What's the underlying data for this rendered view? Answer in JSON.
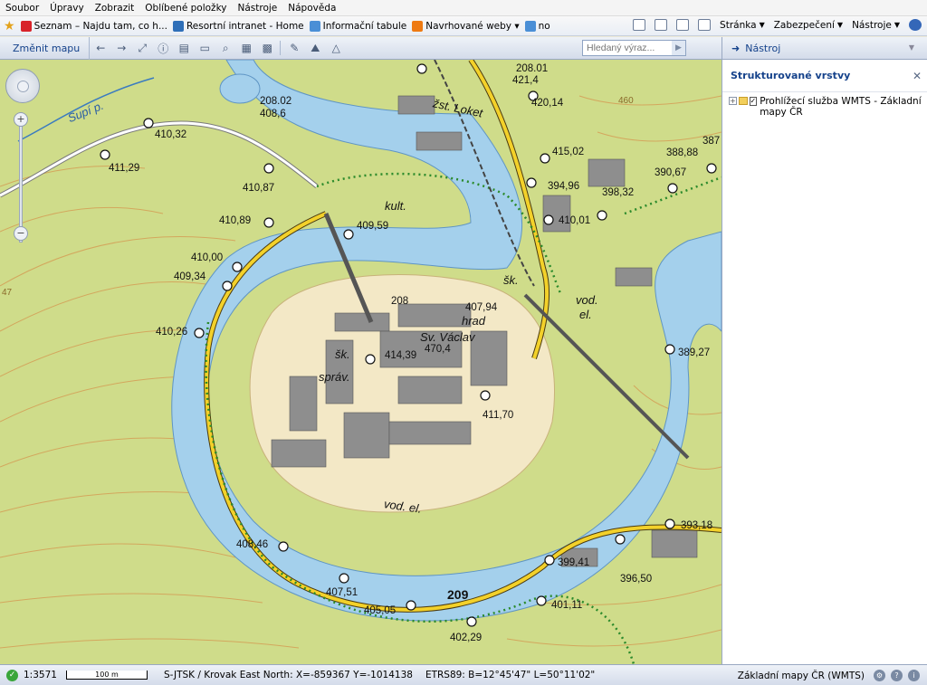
{
  "menu": [
    "Soubor",
    "Úpravy",
    "Zobrazit",
    "Oblíbené položky",
    "Nástroje",
    "Nápověda"
  ],
  "favorites": [
    {
      "label": "Seznam – Najdu tam, co h...",
      "color": "#d8232a"
    },
    {
      "label": "Resortní intranet - Home",
      "color": "#2f6fb8"
    },
    {
      "label": "Informační tabule",
      "color": "#4a8fd6"
    },
    {
      "label": "Navrhované weby ▾",
      "color": "#ee7a12"
    },
    {
      "label": "no",
      "color": "#4a8fd6"
    }
  ],
  "ie_toolbar": {
    "page": "Stránka",
    "security": "Zabezpečení",
    "tools": "Nástroje"
  },
  "app_toolbar": {
    "change_map": "Změnit mapu",
    "search_placeholder": "Hledaný výraz..."
  },
  "tool_panel": {
    "header": "Nástroj",
    "title": "Strukturované vrstvy",
    "layer_label": "Prohlížecí služba WMTS - Základní mapy ČR"
  },
  "map_labels": [
    {
      "text": "Supí p.",
      "cls": "it"
    },
    {
      "text": "208.02"
    },
    {
      "text": "408,6"
    },
    {
      "text": "410,32"
    },
    {
      "text": "411,29"
    },
    {
      "text": "410,87"
    },
    {
      "text": "410,89"
    },
    {
      "text": "409,59"
    },
    {
      "text": "kult.",
      "cls": "it"
    },
    {
      "text": "410,00"
    },
    {
      "text": "409,34"
    },
    {
      "text": "410,26"
    },
    {
      "text": "208.01"
    },
    {
      "text": "421,4"
    },
    {
      "text": "žst. Loket",
      "cls": "it"
    },
    {
      "text": "420,14"
    },
    {
      "text": "415,02"
    },
    {
      "text": "394,96"
    },
    {
      "text": "398,32"
    },
    {
      "text": "410,01"
    },
    {
      "text": "388,88"
    },
    {
      "text": "390,67"
    },
    {
      "text": "387"
    },
    {
      "text": "šk.",
      "cls": "it"
    },
    {
      "text": "208"
    },
    {
      "text": "407,94"
    },
    {
      "text": "hrad",
      "cls": "it"
    },
    {
      "text": "Sv. Václav",
      "cls": "it"
    },
    {
      "text": "vod.",
      "cls": "it"
    },
    {
      "text": "el.",
      "cls": "it"
    },
    {
      "text": "šk.",
      "cls": "it"
    },
    {
      "text": "414,39"
    },
    {
      "text": "470,4"
    },
    {
      "text": "správ.",
      "cls": "it"
    },
    {
      "text": "389,27"
    },
    {
      "text": "411,70"
    },
    {
      "text": "vod. el.",
      "cls": "it"
    },
    {
      "text": "393,18"
    },
    {
      "text": "408,46"
    },
    {
      "text": "399,41"
    },
    {
      "text": "396,50"
    },
    {
      "text": "407,51"
    },
    {
      "text": "405,05"
    },
    {
      "text": "209",
      "cls": "big"
    },
    {
      "text": "401,11"
    },
    {
      "text": "402,29"
    },
    {
      "text": "460"
    },
    {
      "text": "47"
    }
  ],
  "status": {
    "scale": "1:3571",
    "scalebar": "100 m",
    "coords": "S-JTSK / Krovak East North: X=-859367 Y=-1014138",
    "etrs": "ETRS89: B=12°45'47\" L=50°11'02\"",
    "basemap": "Základní mapy ČR (WMTS)"
  }
}
